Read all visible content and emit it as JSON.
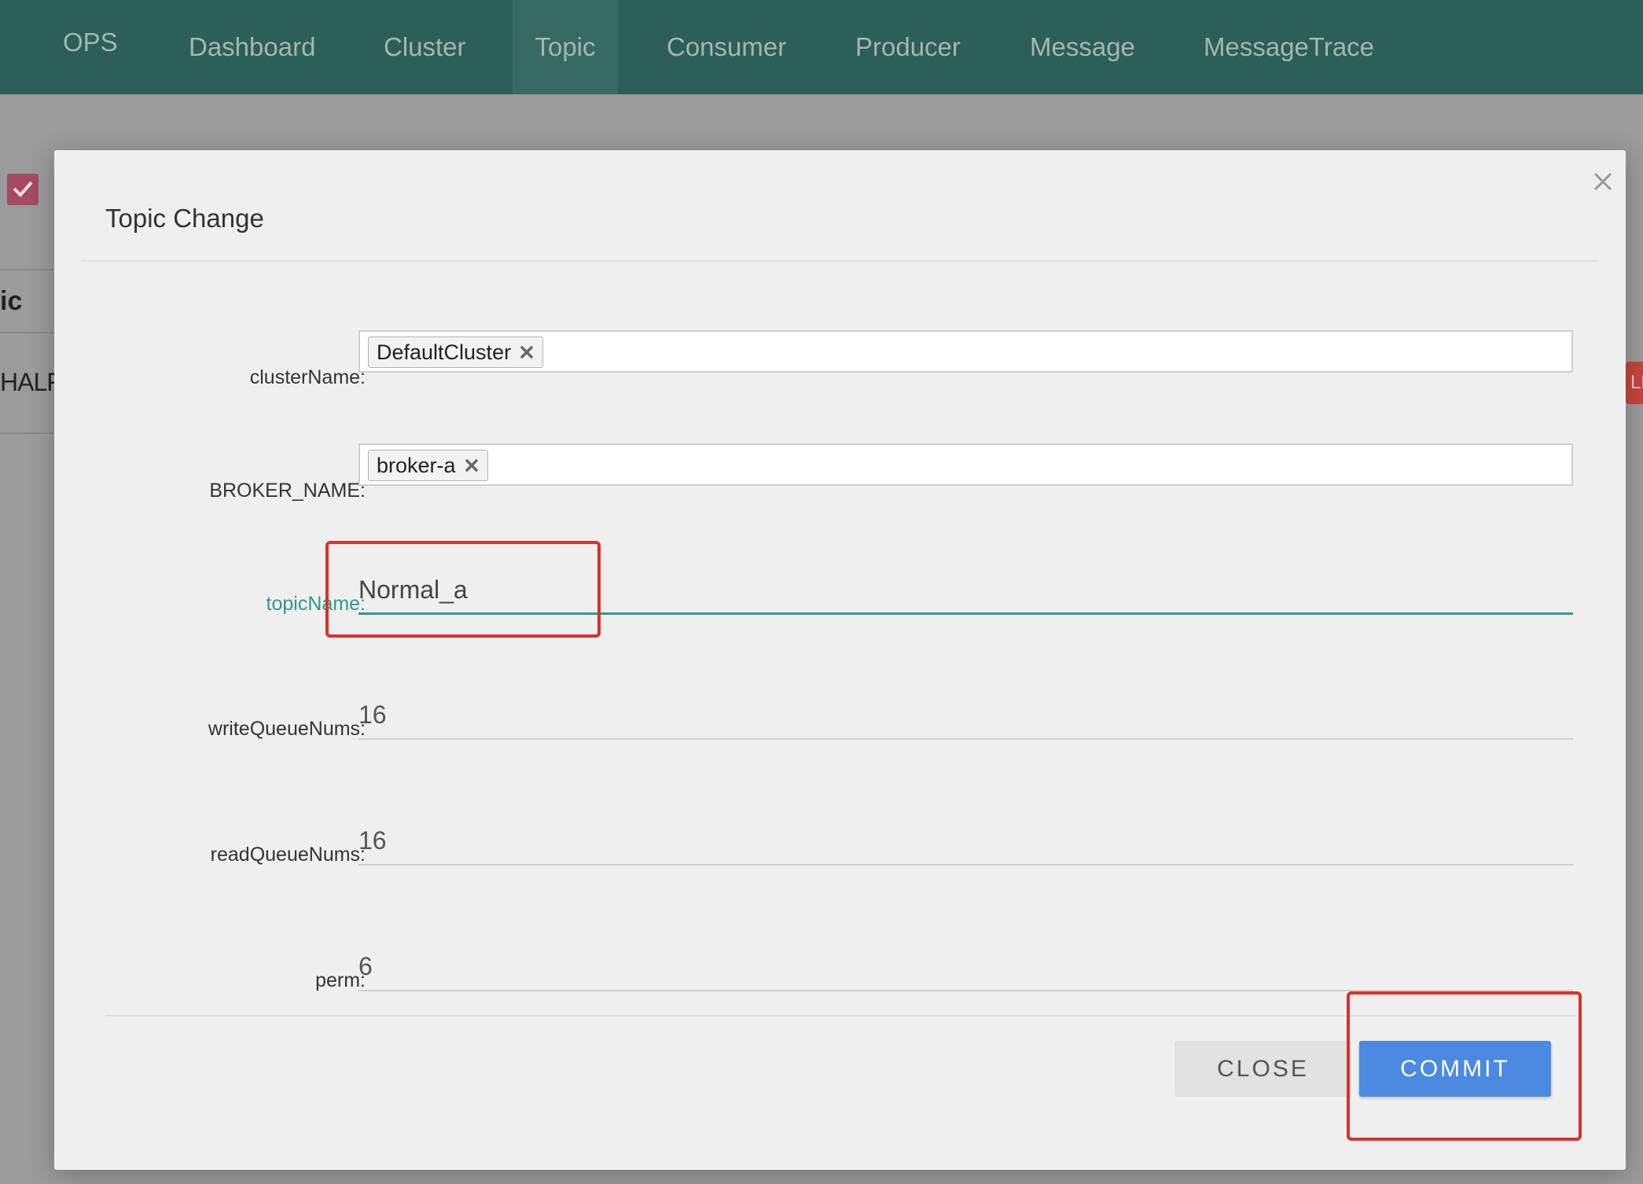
{
  "nav": {
    "brand": "OPS",
    "items": [
      "Dashboard",
      "Cluster",
      "Topic",
      "Consumer",
      "Producer",
      "Message",
      "MessageTrace"
    ],
    "active": "Topic"
  },
  "background": {
    "heading_fragment": "ic",
    "cell_fragment": "HALF",
    "button_fragment": "LE"
  },
  "modal": {
    "title": "Topic Change",
    "fields": {
      "clusterName": {
        "label": "clusterName:",
        "chips": [
          "DefaultCluster"
        ]
      },
      "brokerName": {
        "label": "BROKER_NAME:",
        "chips": [
          "broker-a"
        ]
      },
      "topicName": {
        "label": "topicName:",
        "value": "Normal_a"
      },
      "writeQueueNums": {
        "label": "writeQueueNums:",
        "value": "16"
      },
      "readQueueNums": {
        "label": "readQueueNums:",
        "value": "16"
      },
      "perm": {
        "label": "perm:",
        "value": "6"
      }
    },
    "buttons": {
      "close": "CLOSE",
      "commit": "COMMIT"
    }
  },
  "colors": {
    "navbar": "#2b5f58",
    "focus_accent": "#2f9a86",
    "primary_button": "#4b8ae0",
    "annotation": "#d9312b"
  }
}
